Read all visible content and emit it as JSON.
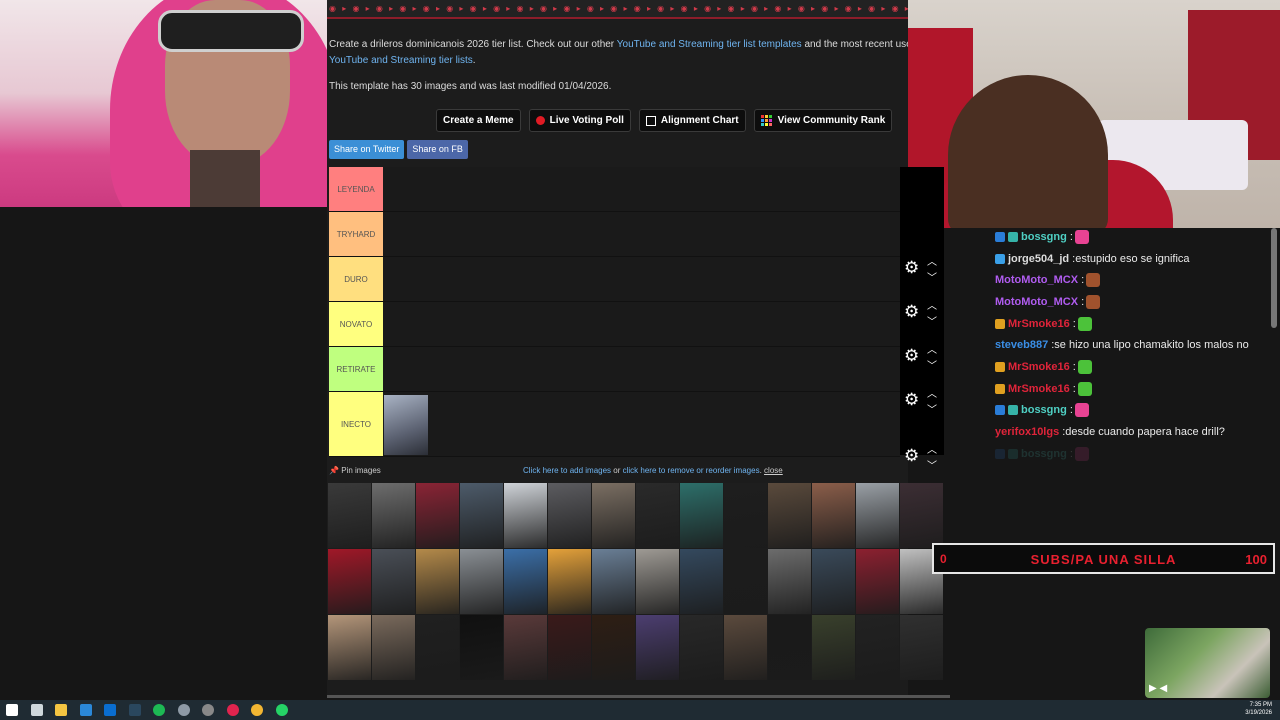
{
  "browser": {
    "ad_strip_text": "◉ ▸ ◉ ▸ ◉ ▸ ◉ ▸ ◉ ▸ ◉ ▸ ◉ ▸ ◉ ▸ ◉ ▸ ◉ ▸ ◉ ▸ ◉ ▸ ◉ ▸ ◉ ▸ ◉ ▸ ◉ ▸ ◉ ▸ ◉ ▸ ◉ ▸ ◉ ▸ ◉ ▸ ◉ ▸ ◉ ▸ ◉ ▸ ◉ ▸ ◉ ▸ ◉ ▸ ◉ ▸",
    "intro_prefix": "Create a drileros dominicanois 2026 tier list. Check out our other ",
    "intro_link1": "YouTube and Streaming tier list templates",
    "intro_mid": " and the most recent user subm",
    "intro_link2": "YouTube and Streaming tier lists",
    "intro_suffix": ".",
    "meta_line": "This template has 30 images and was last modified 01/04/2026.",
    "buttons": {
      "create_meme": "Create a Meme",
      "live_poll": "Live Voting Poll",
      "alignment": "Alignment Chart",
      "community": "View Community Rank"
    },
    "share": {
      "twitter": "Share on Twitter",
      "facebook": "Share on FB"
    },
    "tiers": [
      {
        "label": "LEYENDA",
        "color": "#ff7f7f"
      },
      {
        "label": "TRYHARD",
        "color": "#ffbf7f"
      },
      {
        "label": "DURO",
        "color": "#ffdf7f"
      },
      {
        "label": "NOVATO",
        "color": "#ffff7f"
      },
      {
        "label": "RETIRATE",
        "color": "#bfff7f"
      },
      {
        "label": "INECTO",
        "color": "#ffff7f"
      }
    ],
    "pin_images": "Pin images",
    "add_link": "Click here to add images",
    "or_text": " or ",
    "remove_link": "click here to remove or reorder images",
    "period": ".",
    "close_text": "close",
    "thumb_colors": [
      "#3a3a3a",
      "#6d6d6d",
      "#8a2435",
      "#4d5b6a",
      "#cfd3d8",
      "#5c5c60",
      "#7b6f63",
      "#2a2a2a",
      "#2d6f6a",
      "#1e1e1e",
      "#5a4a3c",
      "#8b5e4a",
      "#9aa0a6",
      "#3c2e34",
      "#a01828",
      "#4a4f57",
      "#b48a4a",
      "#8a8f94",
      "#3b6fa8",
      "#e4a13a",
      "#6a7f96",
      "#9e9a94",
      "#34495e",
      "#1c1c1c",
      "#6c6c6c",
      "#3a4a5a",
      "#8c2030",
      "#c0c0c0",
      "#b4967a",
      "#7a6a5c",
      "#202020",
      "#101010",
      "#5a3a3a",
      "#3a1a1a",
      "#2e1e14",
      "#4c3e70",
      "#282828",
      "#5b4a3d",
      "#1a1a1a",
      "#39402c",
      "#222",
      "#303030"
    ]
  },
  "chat": {
    "messages": [
      {
        "user": "bossgng",
        "color": "#4fd0c4",
        "text": "",
        "badges": [
          "#2a7dd8",
          "#36b3a8"
        ],
        "emote": "#e84393"
      },
      {
        "user": "jorge504_jd",
        "color": "#dddddd",
        "text": "estupido eso se ignifica",
        "badges": [
          "#3aa0e8"
        ],
        "emote": ""
      },
      {
        "user": "MotoMoto_MCX",
        "color": "#b05cf0",
        "text": "",
        "badges": [],
        "emote": "#a0522d"
      },
      {
        "user": "MotoMoto_MCX",
        "color": "#b05cf0",
        "text": "",
        "badges": [],
        "emote": "#a0522d"
      },
      {
        "user": "MrSmoke16",
        "color": "#e0243a",
        "text": "",
        "badges": [
          "#e0a020"
        ],
        "emote": "#4cc23a"
      },
      {
        "user": "steveb887",
        "color": "#3a8ee6",
        "text": "se hizo una lipo chamakito los malos no",
        "badges": [],
        "emote": ""
      },
      {
        "user": "MrSmoke16",
        "color": "#e0243a",
        "text": "",
        "badges": [
          "#e0a020"
        ],
        "emote": "#4cc23a"
      },
      {
        "user": "MrSmoke16",
        "color": "#e0243a",
        "text": "",
        "badges": [
          "#e0a020"
        ],
        "emote": "#4cc23a"
      },
      {
        "user": "bossgng",
        "color": "#4fd0c4",
        "text": "",
        "badges": [
          "#2a7dd8",
          "#36b3a8"
        ],
        "emote": "#e84393"
      },
      {
        "user": "yerifox10lgs",
        "color": "#e0243a",
        "text": "desde cuando papera hace drill?",
        "badges": [],
        "emote": ""
      },
      {
        "user": "bossgng",
        "color": "#4fd0c4",
        "text": "",
        "badges": [
          "#2a7dd8",
          "#36b3a8"
        ],
        "emote": "#e84393"
      }
    ]
  },
  "goal": {
    "left_value": "0",
    "label": "SUBS/PA UNA SILLA",
    "right_value": "100"
  },
  "taskbar": {
    "time": "7:35 PM",
    "date": "3/19/2026",
    "icons": [
      "windows-icon",
      "search-icon",
      "file-explorer-icon",
      "edge-icon",
      "store-icon",
      "steam-icon",
      "spotify-icon",
      "app-icon",
      "obs-icon",
      "tiktok-icon",
      "chrome-icon",
      "whatsapp-icon"
    ]
  }
}
